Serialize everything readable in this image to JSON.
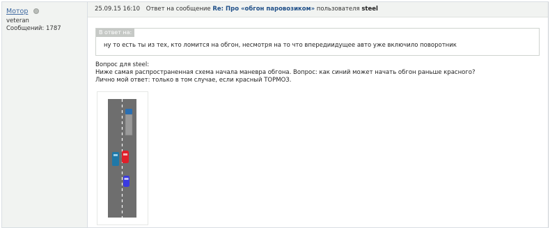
{
  "sidebar": {
    "author": "Мотор",
    "rank": "veteran",
    "messages_label": "Сообщений:",
    "messages_count": "1787"
  },
  "header": {
    "date": "25.09.15 16:10",
    "reply_prefix": "Ответ на сообщение",
    "reply_link": "Re: Про «обгон паровозиком»",
    "user_prefix": "пользователя",
    "user": "steel"
  },
  "quote": {
    "label": "В ответ на:",
    "text": "ну то есть ты из тех, кто ломится на обгон, несмотря на то что впередиидущее авто уже включило поворотник"
  },
  "body": {
    "line1": "Вопрос для steel:",
    "line2": "Ниже самая распространенная схема начала маневра обгона. Вопрос: как синий может начать обгон раньше красного?",
    "line3": "Лично мой ответ: только в том случае, если красный ТОРМОЗ."
  },
  "colors": {
    "road": "#6e6e6e",
    "truck_cab": "#2a6fb2",
    "truck_trailer": "#9a9a9a",
    "red_car": "#e0202a",
    "teal_car": "#1f78a8",
    "blue_car": "#3a3ae0"
  }
}
